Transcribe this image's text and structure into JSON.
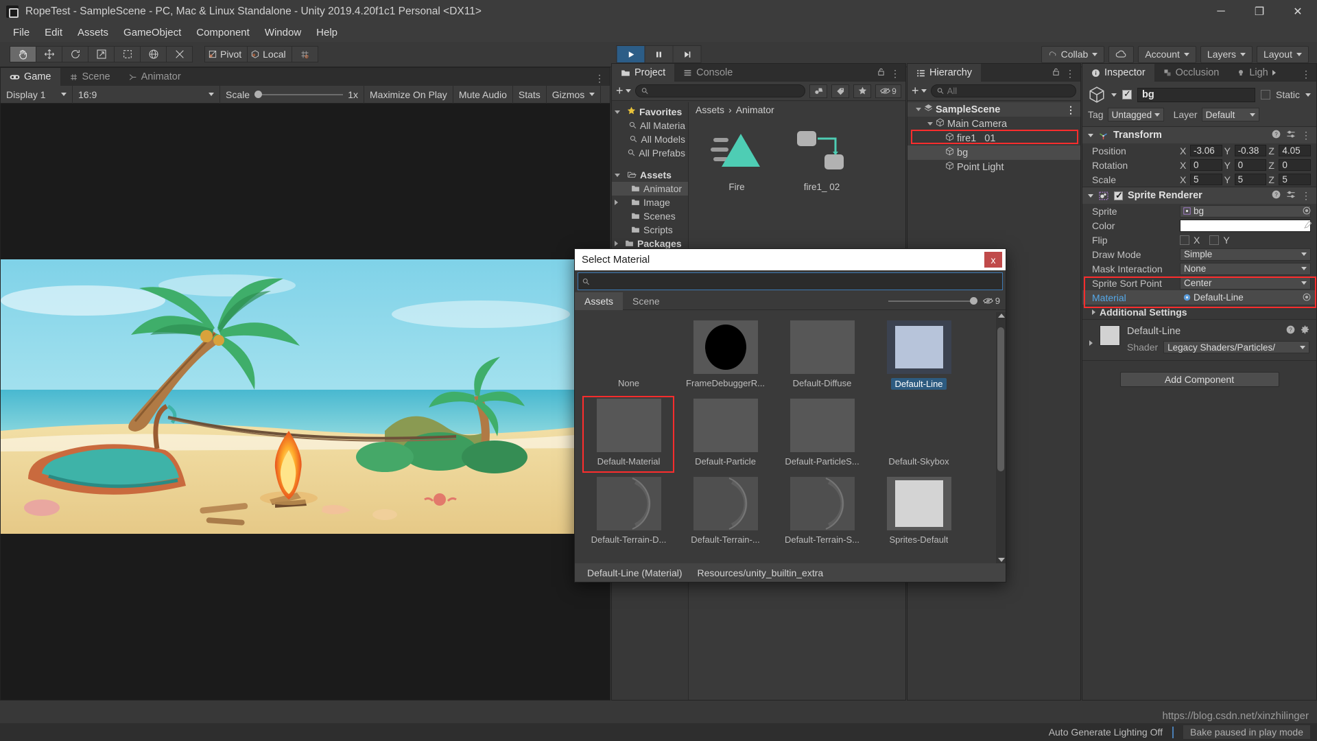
{
  "window": {
    "title": "RopeTest - SampleScene - PC, Mac & Linux Standalone - Unity 2019.4.20f1c1 Personal <DX11>",
    "minimize": "─",
    "maximize": "❐",
    "close": "✕"
  },
  "menu": {
    "items": [
      "File",
      "Edit",
      "Assets",
      "GameObject",
      "Component",
      "Window",
      "Help"
    ]
  },
  "toolbar": {
    "tools": [
      "hand-tool",
      "move-tool",
      "rotate-tool",
      "scale-tool",
      "rect-tool",
      "transform-tool",
      "custom-tool"
    ],
    "pivot_label": "Pivot",
    "local_label": "Local",
    "play": "▶",
    "pause": "❙❙",
    "step": "▶|",
    "collab_label": "Collab",
    "account_label": "Account",
    "layers_label": "Layers",
    "layout_label": "Layout"
  },
  "game": {
    "tabs": [
      {
        "label": "Game",
        "icon": "gamepad-icon",
        "selected": true
      },
      {
        "label": "Scene",
        "icon": "grid-icon",
        "selected": false
      },
      {
        "label": "Animator",
        "icon": "animator-icon",
        "selected": false
      }
    ],
    "display": "Display 1",
    "aspect": "16:9",
    "scale_label": "Scale",
    "scale_value": "1x",
    "maximize_on_play": "Maximize On Play",
    "mute_audio": "Mute Audio",
    "stats": "Stats",
    "gizmos": "Gizmos"
  },
  "project": {
    "tabs": [
      {
        "label": "Project",
        "icon": "folder-icon",
        "selected": true
      },
      {
        "label": "Console",
        "icon": "console-icon",
        "selected": false
      }
    ],
    "search_placeholder": "",
    "hidden_count": "9",
    "tree": [
      {
        "label": "Favorites",
        "icon": "star-icon",
        "depth": 0,
        "arrow": "down",
        "bold": true,
        "selected": false
      },
      {
        "label": "All Materia",
        "icon": "search-icon",
        "depth": 1,
        "arrow": "none",
        "bold": false,
        "selected": false
      },
      {
        "label": "All Models",
        "icon": "search-icon",
        "depth": 1,
        "arrow": "none",
        "bold": false,
        "selected": false
      },
      {
        "label": "All Prefabs",
        "icon": "search-icon",
        "depth": 1,
        "arrow": "none",
        "bold": false,
        "selected": false
      },
      {
        "label": "",
        "icon": "none",
        "depth": 0,
        "arrow": "none",
        "bold": false,
        "selected": false
      },
      {
        "label": "Assets",
        "icon": "open-folder-icon",
        "depth": 0,
        "arrow": "down",
        "bold": true,
        "selected": false
      },
      {
        "label": "Animator",
        "icon": "folder-icon",
        "depth": 1,
        "arrow": "none",
        "bold": false,
        "selected": true
      },
      {
        "label": "Image",
        "icon": "folder-icon",
        "depth": 1,
        "arrow": "right",
        "bold": false,
        "selected": false
      },
      {
        "label": "Scenes",
        "icon": "folder-icon",
        "depth": 1,
        "arrow": "none",
        "bold": false,
        "selected": false
      },
      {
        "label": "Scripts",
        "icon": "folder-icon",
        "depth": 1,
        "arrow": "none",
        "bold": false,
        "selected": false
      },
      {
        "label": "Packages",
        "icon": "folder-icon",
        "depth": 0,
        "arrow": "right",
        "bold": true,
        "selected": false
      }
    ],
    "breadcrumb": [
      "Assets",
      "Animator"
    ],
    "assets": [
      {
        "label": "Fire",
        "icon": "triangle-asset"
      },
      {
        "label": "fire1_ 02",
        "icon": "animator-asset"
      }
    ]
  },
  "hierarchy": {
    "tab_label": "Hierarchy",
    "search_placeholder": "All",
    "items": [
      {
        "label": "SampleScene",
        "depth": 0,
        "arrow": "down",
        "icon": "scene-icon",
        "kind": "scene",
        "selected": false,
        "highlighted": false
      },
      {
        "label": "Main Camera",
        "depth": 1,
        "arrow": "down",
        "icon": "cube-icon",
        "kind": "object",
        "selected": false,
        "highlighted": false
      },
      {
        "label": "fire1_ 01",
        "depth": 2,
        "arrow": "none",
        "icon": "cube-icon",
        "kind": "object",
        "selected": false,
        "highlighted": false
      },
      {
        "label": "bg",
        "depth": 2,
        "arrow": "none",
        "icon": "cube-icon",
        "kind": "object",
        "selected": true,
        "highlighted": true
      },
      {
        "label": "Point Light",
        "depth": 2,
        "arrow": "none",
        "icon": "cube-icon",
        "kind": "object",
        "selected": false,
        "highlighted": false
      }
    ]
  },
  "inspector": {
    "tabs": [
      {
        "label": "Inspector",
        "icon": "info-icon",
        "selected": true
      },
      {
        "label": "Occlusion",
        "icon": "occlusion-icon",
        "selected": false
      },
      {
        "label": "Ligh",
        "icon": "light-icon",
        "selected": false
      }
    ],
    "object_name": "bg",
    "object_enabled": true,
    "static_label": "Static",
    "static_checked": false,
    "tag_label": "Tag",
    "tag_value": "Untagged",
    "layer_label": "Layer",
    "layer_value": "Default",
    "transform": {
      "title": "Transform",
      "rows": [
        {
          "label": "Position",
          "x": "-3.06",
          "y": "-0.38",
          "z": "4.05"
        },
        {
          "label": "Rotation",
          "x": "0",
          "y": "0",
          "z": "0"
        },
        {
          "label": "Scale",
          "x": "5",
          "y": "5",
          "z": "5"
        }
      ]
    },
    "sprite_renderer": {
      "title": "Sprite Renderer",
      "enabled": true,
      "sprite_label": "Sprite",
      "sprite_value": "bg",
      "color_label": "Color",
      "color_value": "#ffffff",
      "flip_label": "Flip",
      "flip_x": "X",
      "flip_y": "Y",
      "draw_mode_label": "Draw Mode",
      "draw_mode_value": "Simple",
      "mask_label": "Mask Interaction",
      "mask_value": "None",
      "sort_point_label": "Sprite Sort Point",
      "sort_point_value": "Center",
      "material_label": "Material",
      "material_value": "Default-Line",
      "additional_label": "Additional Settings"
    },
    "material_preview": {
      "name": "Default-Line",
      "shader_label": "Shader",
      "shader_value": "Legacy Shaders/Particles/"
    },
    "add_component": "Add Component"
  },
  "dialog": {
    "title": "Select Material",
    "close": "x",
    "search_value": "",
    "tabs": [
      {
        "label": "Assets",
        "selected": true
      },
      {
        "label": "Scene",
        "selected": false
      }
    ],
    "hidden_count": "9",
    "rows": [
      [
        {
          "name": "None",
          "thumb": "none",
          "selected": false,
          "outlined": false
        },
        {
          "name": "FrameDebuggerR...",
          "thumb": "black-sphere",
          "selected": false,
          "outlined": false
        },
        {
          "name": "Default-Diffuse",
          "thumb": "gray-sphere",
          "selected": false,
          "outlined": false
        },
        {
          "name": "Default-Line",
          "thumb": "blue-flat",
          "selected": true,
          "outlined": false
        }
      ],
      [
        {
          "name": "Default-Material",
          "thumb": "gray-sphere",
          "selected": false,
          "outlined": true
        },
        {
          "name": "Default-Particle",
          "thumb": "glow",
          "selected": false,
          "outlined": false
        },
        {
          "name": "Default-ParticleS...",
          "thumb": "glow",
          "selected": false,
          "outlined": false
        },
        {
          "name": "Default-Skybox",
          "thumb": "skybox",
          "selected": false,
          "outlined": false
        }
      ],
      [
        {
          "name": "Default-Terrain-D...",
          "thumb": "terrain",
          "selected": false,
          "outlined": false
        },
        {
          "name": "Default-Terrain-...",
          "thumb": "terrain",
          "selected": false,
          "outlined": false
        },
        {
          "name": "Default-Terrain-S...",
          "thumb": "terrain",
          "selected": false,
          "outlined": false
        },
        {
          "name": "Sprites-Default",
          "thumb": "white-flat",
          "selected": false,
          "outlined": false
        }
      ]
    ],
    "status_name": "Default-Line (Material)",
    "status_path": "Resources/unity_builtin_extra"
  },
  "status": {
    "lighting": "Auto Generate Lighting Off",
    "bake": "Bake paused in play mode",
    "watermark": "https://blog.csdn.net/xinzhilinger"
  },
  "colors": {
    "accent_blue": "#2d5b80",
    "highlight_red": "#ff2d2d",
    "panel_bg": "#383838",
    "title_bg": "#3c3c3c"
  }
}
